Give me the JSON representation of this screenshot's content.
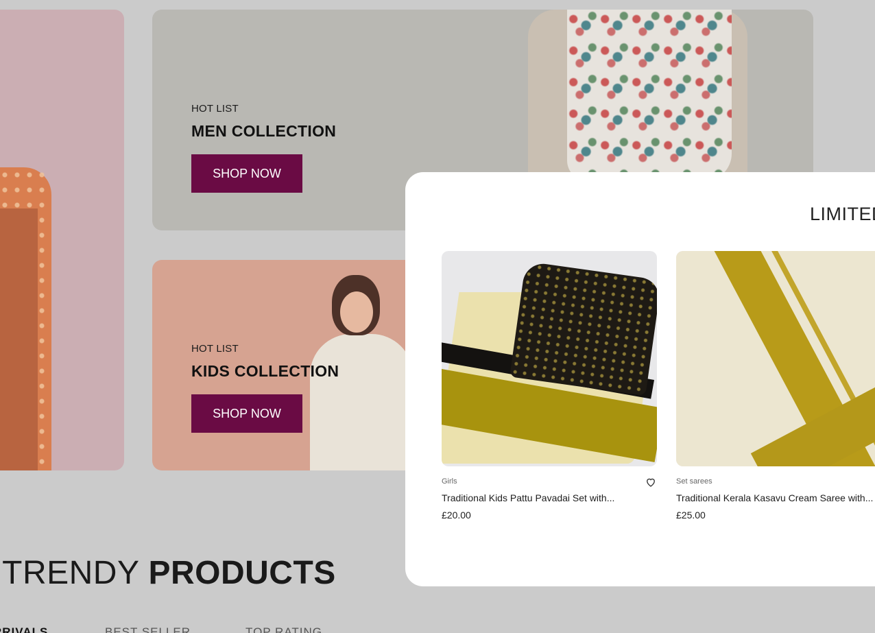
{
  "banners": {
    "men": {
      "kicker": "HOT LIST",
      "title": "MEN COLLECTION",
      "cta": "SHOP NOW"
    },
    "kids": {
      "kicker": "HOT LIST",
      "title": "KIDS COLLECTION",
      "cta": "SHOP NOW"
    }
  },
  "panel": {
    "heading": "LIMITED",
    "products": [
      {
        "category": "Girls",
        "title": "Traditional Kids Pattu Pavadai Set with...",
        "price": "£20.00",
        "wishlist_icon": "heart-outline-icon"
      },
      {
        "category": "Set sarees",
        "title": "Traditional Kerala Kasavu Cream Saree with...",
        "price": "£25.00"
      }
    ]
  },
  "trendy": {
    "title_prefix": "R TRENDY",
    "title_bold": "PRODUCTS",
    "tabs": [
      "RRIVALS",
      "BEST SELLER",
      "TOP RATING"
    ]
  },
  "colors": {
    "brand": "#6a0b44",
    "page_bg": "#cbcbcb",
    "men_banner_bg": "#b9b8b3",
    "kids_banner_bg": "#d6a391",
    "left_banner_bg": "#cbaeb3"
  }
}
